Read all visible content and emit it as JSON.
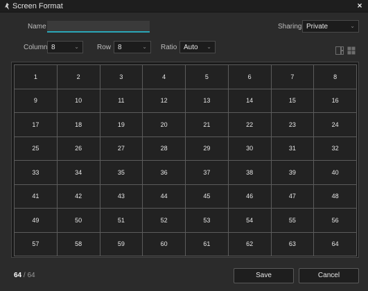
{
  "window": {
    "title": "Screen Format",
    "close_glyph": "×"
  },
  "form": {
    "name_label": "Name",
    "name_value": "",
    "sharing_label": "Sharing",
    "sharing_value": "Private",
    "column_label": "Column",
    "column_value": "8",
    "row_label": "Row",
    "row_value": "8",
    "ratio_label": "Ratio",
    "ratio_value": "Auto"
  },
  "icons": {
    "window": "window-icon",
    "layout_a": "split-layout-icon",
    "layout_b": "grid-layout-icon",
    "accent": "#2aa7b8"
  },
  "grid": {
    "columns": 8,
    "rows": 8,
    "cells": [
      "1",
      "2",
      "3",
      "4",
      "5",
      "6",
      "7",
      "8",
      "9",
      "10",
      "11",
      "12",
      "13",
      "14",
      "15",
      "16",
      "17",
      "18",
      "19",
      "20",
      "21",
      "22",
      "23",
      "24",
      "25",
      "26",
      "27",
      "28",
      "29",
      "30",
      "31",
      "32",
      "33",
      "34",
      "35",
      "36",
      "37",
      "38",
      "39",
      "40",
      "41",
      "42",
      "43",
      "44",
      "45",
      "46",
      "47",
      "48",
      "49",
      "50",
      "51",
      "52",
      "53",
      "54",
      "55",
      "56",
      "57",
      "58",
      "59",
      "60",
      "61",
      "62",
      "63",
      "64"
    ]
  },
  "footer": {
    "count_current": "64",
    "count_separator": "/",
    "count_total": "64",
    "save_label": "Save",
    "cancel_label": "Cancel"
  }
}
